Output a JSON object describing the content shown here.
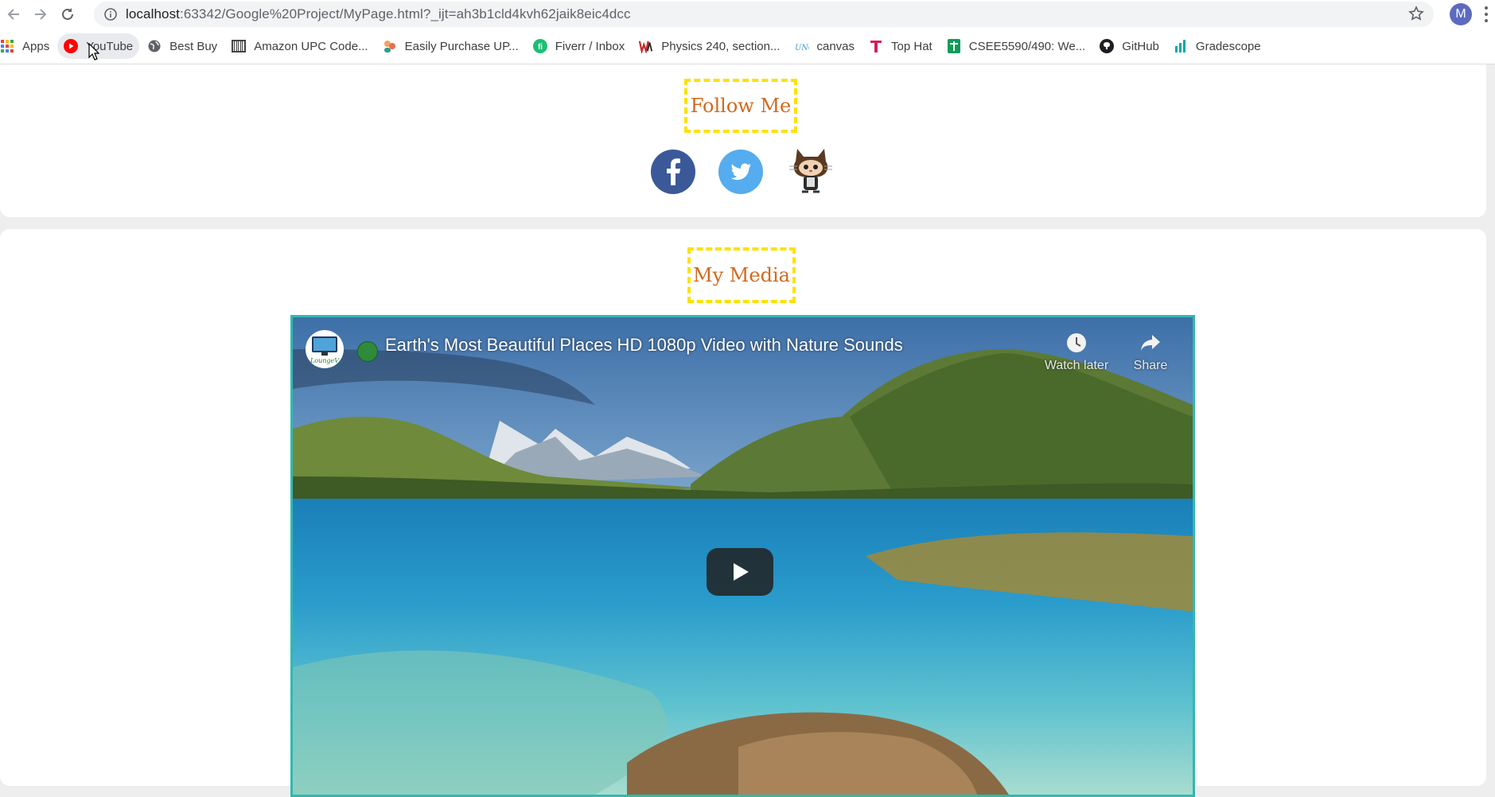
{
  "browser": {
    "url_host": "localhost",
    "url_rest": ":63342/Google%20Project/MyPage.html?_ijt=ah3b1cld4kvh62jaik8eic4dcc",
    "profile_initial": "M"
  },
  "bookmarks": [
    {
      "label": "Apps",
      "icon": "apps-grid-icon"
    },
    {
      "label": "YouTube",
      "icon": "youtube-icon"
    },
    {
      "label": "Best Buy",
      "icon": "globe-icon"
    },
    {
      "label": "Amazon UPC Code...",
      "icon": "barcode-icon"
    },
    {
      "label": "Easily Purchase UP...",
      "icon": "people-icon"
    },
    {
      "label": "Fiverr / Inbox",
      "icon": "fiverr-icon"
    },
    {
      "label": "Physics 240, section...",
      "icon": "webassign-icon"
    },
    {
      "label": "canvas",
      "icon": "unc-icon"
    },
    {
      "label": "Top Hat",
      "icon": "tophat-icon"
    },
    {
      "label": "CSEE5590/490: We...",
      "icon": "sheets-icon"
    },
    {
      "label": "GitHub",
      "icon": "github-icon"
    },
    {
      "label": "Gradescope",
      "icon": "gradescope-icon"
    }
  ],
  "follow": {
    "title": "Follow Me",
    "links": [
      {
        "name": "facebook",
        "icon": "facebook-icon"
      },
      {
        "name": "twitter",
        "icon": "twitter-icon"
      },
      {
        "name": "github",
        "icon": "octocat-icon"
      }
    ]
  },
  "media": {
    "title": "My Media",
    "video_title": "Earth's Most Beautiful Places HD 1080p Video with Nature Sounds",
    "watch_later": "Watch later",
    "share": "Share",
    "channel_logo_text": "LoungeV"
  },
  "colors": {
    "title_text": "#d2691e",
    "title_border": "#ffe100",
    "video_border": "#32b8b0",
    "facebook": "#3b5998",
    "twitter": "#55acee"
  }
}
